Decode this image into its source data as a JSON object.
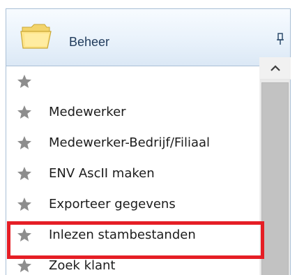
{
  "panel": {
    "title": "Beheer",
    "header_icon": "folder-icon",
    "pin_icon": "pin-icon",
    "item_icon": "star-icon"
  },
  "items": [
    {
      "label": ""
    },
    {
      "label": "Medewerker"
    },
    {
      "label": "Medewerker-Bedrijf/Filiaal"
    },
    {
      "label": "ENV AscII maken"
    },
    {
      "label": "Exporteer gegevens"
    },
    {
      "label": "Inlezen stambestanden",
      "highlighted": true
    },
    {
      "label": "Zoek klant"
    }
  ],
  "colors": {
    "highlight": "#e51e25",
    "header_text": "#1f3a5b",
    "star": "#8d8d8d"
  }
}
